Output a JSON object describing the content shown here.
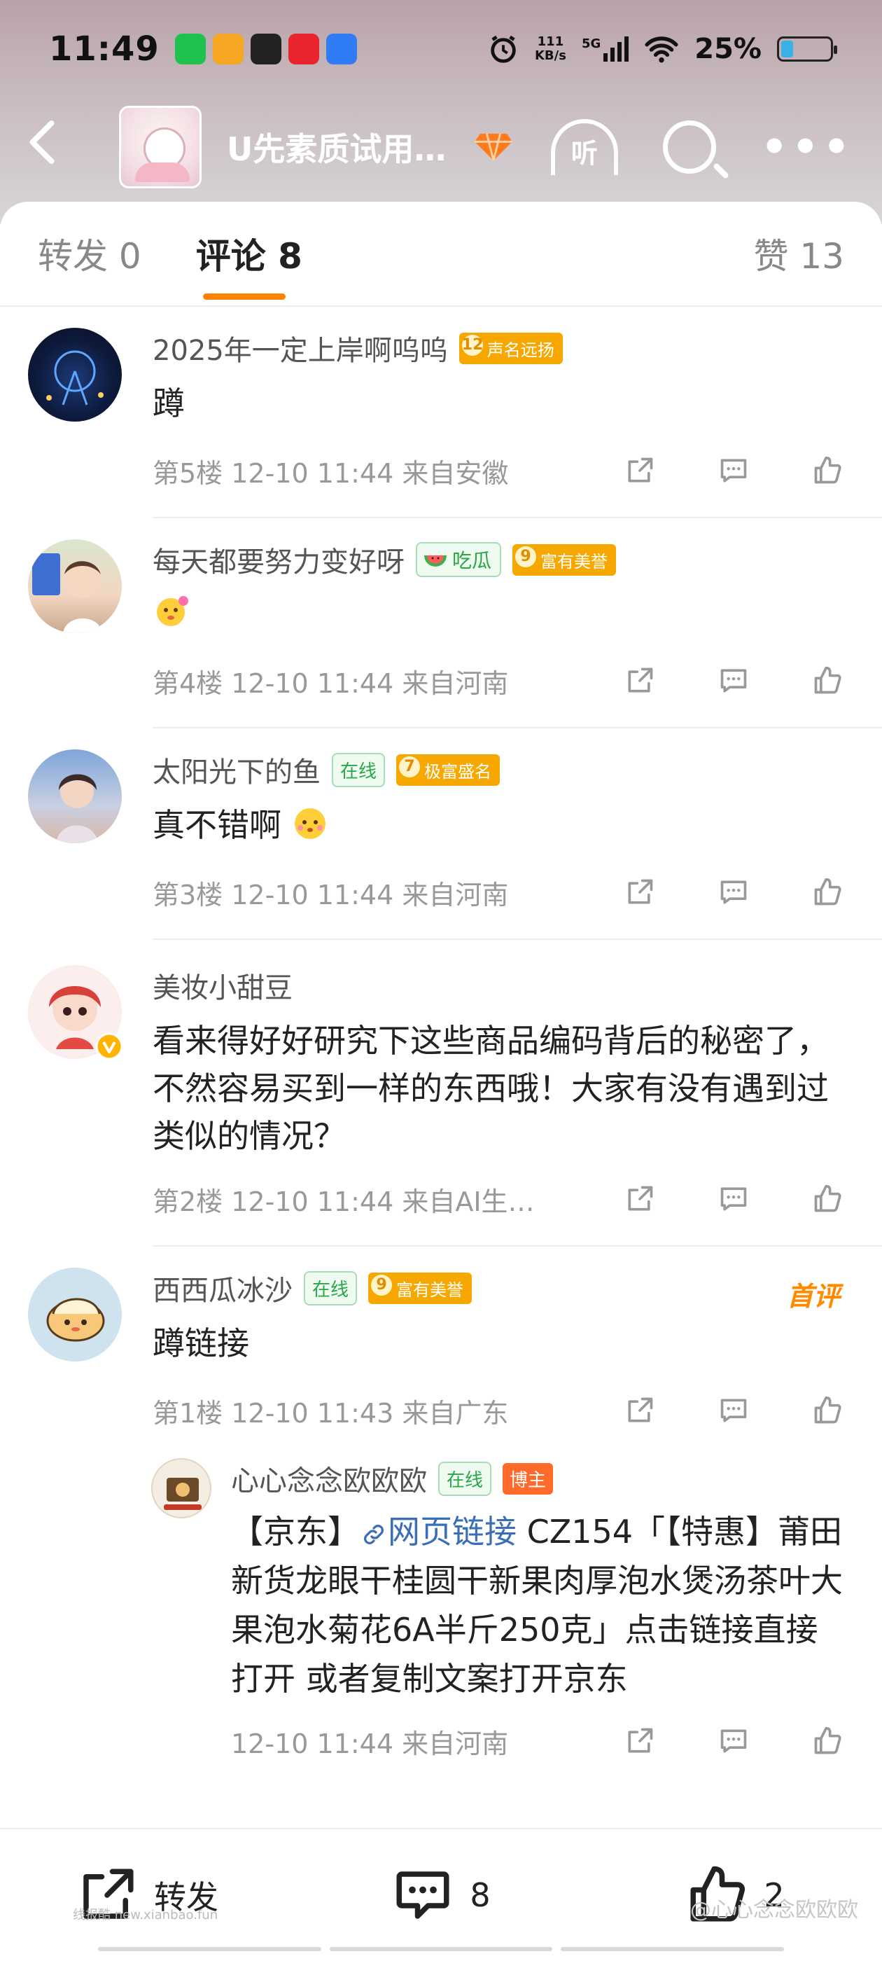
{
  "status_bar": {
    "time": "11:49",
    "net_speed_top": "111",
    "net_speed_unit": "KB/s",
    "signal": "5G",
    "battery": "25%",
    "battery_level": 0.25
  },
  "header": {
    "title": "U先素质试用…",
    "listen_label": "听"
  },
  "tabs": {
    "repost": "转发 0",
    "comments": "评论 8",
    "likes": "赞 13"
  },
  "comments": [
    {
      "name": "2025年一定上岸啊呜呜",
      "level": "12",
      "level_title": "声名远扬",
      "text": "蹲",
      "meta": "第5楼  12-10 11:44  来自安徽"
    },
    {
      "name": "每天都要努力变好呀",
      "melon": "吃瓜",
      "level": "9",
      "level_title": "富有美誉",
      "text": "",
      "meta": "第4楼  12-10 11:44  来自河南"
    },
    {
      "name": "太阳光下的鱼",
      "online": "在线",
      "level": "7",
      "level_title": "极富盛名",
      "text": "真不错啊",
      "meta": "第3楼  12-10 11:44  来自河南"
    },
    {
      "name": "美妆小甜豆",
      "text": "看来得好好研究下这些商品编码背后的秘密了，不然容易买到一样的东西哦！大家有没有遇到过类似的情况？",
      "meta": "第2楼  12-10 11:44  来自AI生…"
    },
    {
      "name": "西西瓜冰沙",
      "online": "在线",
      "level": "9",
      "level_title": "富有美誉",
      "first_tag": "首评",
      "text": "蹲链接",
      "meta": "第1楼  12-10 11:43  来自广东"
    }
  ],
  "reply": {
    "name": "心心念念欧欧欧",
    "online": "在线",
    "owner": "博主",
    "text_prefix": "【京东】",
    "link_text": "网页链接",
    "text_rest": " CZ154「【特惠】莆田新货龙眼干桂圆干新果肉厚泡水煲汤茶叶大果泡水菊花6A半斤250克」点击链接直接打开 或者复制文案打开京东",
    "meta": "12-10 11:44  来自河南"
  },
  "bottom_bar": {
    "repost": "转发",
    "comments_count": "8",
    "likes_count": "2"
  },
  "watermarks": {
    "left": "线报酷 new.xianbao.fun",
    "right": "@心心念念欧欧欧"
  },
  "colors": {
    "accent": "#ff8200",
    "link": "#3a6fb8",
    "online_green": "#2aa748",
    "level_badge": "#f7a800"
  }
}
